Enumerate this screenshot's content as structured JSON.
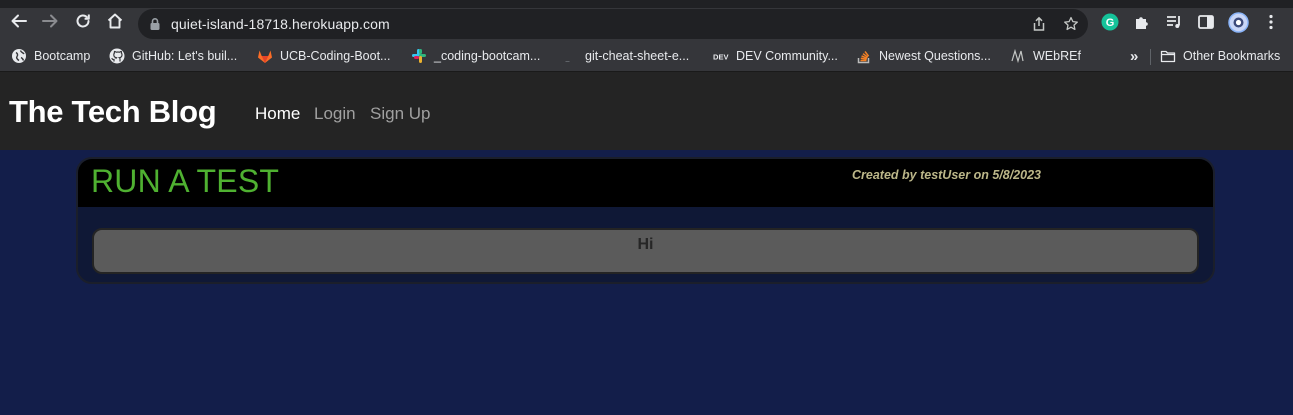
{
  "browser": {
    "url": "quiet-island-18718.herokuapp.com",
    "icons": [
      "back-arrow-icon",
      "forward-arrow-icon",
      "reload-icon",
      "home-icon",
      "lock-icon",
      "share-icon",
      "star-icon",
      "grammarly-icon",
      "extensions-icon",
      "reading-list-icon",
      "side-panel-icon",
      "profile-icon",
      "menu-icon"
    ]
  },
  "bookmarks": {
    "items": [
      {
        "label": "Bootcamp",
        "icon": "globe-icon"
      },
      {
        "label": "GitHub: Let's buil...",
        "icon": "github-icon"
      },
      {
        "label": "UCB-Coding-Boot...",
        "icon": "gitlab-icon"
      },
      {
        "label": "_coding-bootcam...",
        "icon": "slack-icon"
      },
      {
        "label": "git-cheat-sheet-e...",
        "icon": "blank-page-icon"
      },
      {
        "label": "DEV Community...",
        "icon": "dev-icon"
      },
      {
        "label": "Newest Questions...",
        "icon": "stackoverflow-icon"
      },
      {
        "label": "WEbREf",
        "icon": "m-icon"
      }
    ],
    "overflow": "»",
    "other": "Other Bookmarks"
  },
  "site": {
    "brand": "The Tech Blog",
    "nav": [
      "Home",
      "Login",
      "Sign Up"
    ]
  },
  "post": {
    "title": "RUN A TEST",
    "meta": "Created by testUser on 5/8/2023",
    "body": "Hi"
  },
  "colors": {
    "page_bg": "#131e4a",
    "header_bg": "#242424",
    "title_green": "#4fb131",
    "meta_gold": "#bcb789",
    "body_box": "#5b5b5b"
  }
}
